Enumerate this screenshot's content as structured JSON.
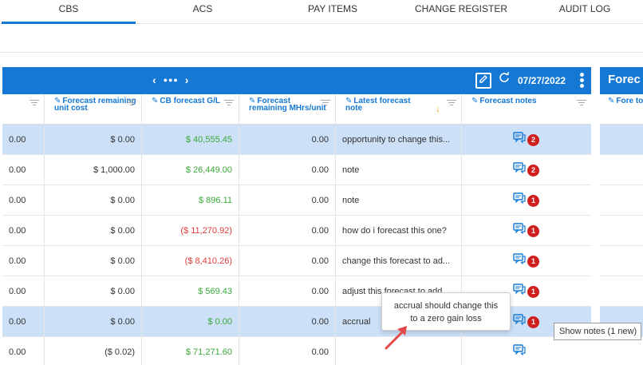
{
  "top_tabs": [
    {
      "label": "CBS",
      "active": true
    },
    {
      "label": "ACS",
      "active": false
    },
    {
      "label": "PAY ITEMS",
      "active": false
    },
    {
      "label": "CHANGE REGISTER",
      "active": false
    },
    {
      "label": "AUDIT LOG",
      "active": false
    }
  ],
  "grid": {
    "header": {
      "pager_prev": "‹",
      "pager_dots": "●●●",
      "pager_next": "›",
      "edit_icon": "edit-icon",
      "refresh_icon": "refresh-icon",
      "date": "07/27/2022",
      "kebab_icon": "more-vertical-icon"
    },
    "columns": [
      {
        "title": "",
        "editable": false,
        "filter": true
      },
      {
        "title": "Forecast remaining unit cost",
        "editable": true,
        "filter": true
      },
      {
        "title": "CB forecast G/L",
        "editable": true,
        "filter": true
      },
      {
        "title": "Forecast remaining MHrs/unit",
        "editable": true,
        "filter": true
      },
      {
        "title": "Latest forecast note",
        "editable": true,
        "filter": true,
        "sorted": true
      },
      {
        "title": "Forecast notes",
        "editable": true,
        "filter": true
      }
    ],
    "rows": [
      {
        "c0": "0.00",
        "c1": "$ 0.00",
        "c2": "$ 40,555.45",
        "c2_tone": "pos",
        "c3": "0.00",
        "c4": "opportunity to change this...",
        "notes": "2",
        "selected": true
      },
      {
        "c0": "0.00",
        "c1": "$ 1,000.00",
        "c2": "$ 26,449.00",
        "c2_tone": "pos",
        "c3": "0.00",
        "c4": "note",
        "notes": "2",
        "selected": false
      },
      {
        "c0": "0.00",
        "c1": "$ 0.00",
        "c2": "$ 896.11",
        "c2_tone": "pos",
        "c3": "0.00",
        "c4": "note",
        "notes": "1",
        "selected": false
      },
      {
        "c0": "0.00",
        "c1": "$ 0.00",
        "c2": "($ 11,270.92)",
        "c2_tone": "neg",
        "c3": "0.00",
        "c4": "how do i forecast this one?",
        "notes": "1",
        "selected": false
      },
      {
        "c0": "0.00",
        "c1": "$ 0.00",
        "c2": "($ 8,410.26)",
        "c2_tone": "neg",
        "c3": "0.00",
        "c4": "change this forecast to ad...",
        "notes": "1",
        "selected": false
      },
      {
        "c0": "0.00",
        "c1": "$ 0.00",
        "c2": "$ 569.43",
        "c2_tone": "pos",
        "c3": "0.00",
        "c4": "adjust this forecast to add ...",
        "notes": "1",
        "selected": false
      },
      {
        "c0": "0.00",
        "c1": "$ 0.00",
        "c2": "$ 0.00",
        "c2_tone": "pos",
        "c3": "0.00",
        "c4": "accrual",
        "notes": "1",
        "selected": true
      },
      {
        "c0": "0.00",
        "c1": "($ 0.02)",
        "c2": "$ 71,271.60",
        "c2_tone": "pos",
        "c3": "0.00",
        "c4": "",
        "notes": "",
        "selected": false
      }
    ]
  },
  "panel2": {
    "title": "Forec",
    "column_title": "Fore total cos"
  },
  "popover": {
    "line1": "accrual should change this",
    "line2": "to a zero gain loss"
  },
  "tooltip": {
    "text": "Show notes (1 new)"
  },
  "colors": {
    "accent": "#1478d4",
    "selected_row": "#cce0f7",
    "positive": "#3aa83a",
    "negative": "#e23b3b",
    "badge": "#d01f1f",
    "sort_arrow": "#f0a020"
  }
}
